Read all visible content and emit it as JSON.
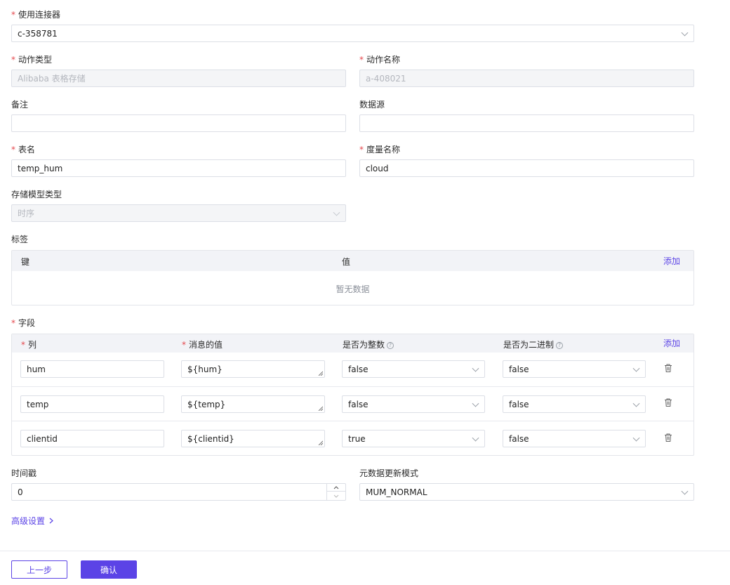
{
  "connector": {
    "label": "使用连接器",
    "value": "c-358781"
  },
  "action_type": {
    "label": "动作类型",
    "value": "Alibaba 表格存储"
  },
  "action_name": {
    "label": "动作名称",
    "value": "a-408021"
  },
  "remark": {
    "label": "备注",
    "value": ""
  },
  "data_source": {
    "label": "数据源",
    "value": ""
  },
  "table_name": {
    "label": "表名",
    "value": "temp_hum"
  },
  "measurement": {
    "label": "度量名称",
    "value": "cloud"
  },
  "storage_model": {
    "label": "存储模型类型",
    "value": "时序"
  },
  "tags": {
    "label": "标签",
    "col_key": "键",
    "col_value": "值",
    "add_label": "添加",
    "empty_text": "暂无数据"
  },
  "fields": {
    "label": "字段",
    "col_column": "列",
    "col_msg_value": "消息的值",
    "col_is_integer": "是否为整数",
    "col_is_binary": "是否为二进制",
    "add_label": "添加",
    "help_glyph": "?",
    "rows": [
      {
        "column": "hum",
        "msg_value": "${hum}",
        "is_integer": "false",
        "is_binary": "false"
      },
      {
        "column": "temp",
        "msg_value": "${temp}",
        "is_integer": "false",
        "is_binary": "false"
      },
      {
        "column": "clientid",
        "msg_value": "${clientid}",
        "is_integer": "true",
        "is_binary": "false"
      }
    ]
  },
  "timestamp": {
    "label": "时间戳",
    "value": "0"
  },
  "meta_update_mode": {
    "label": "元数据更新模式",
    "value": "MUM_NORMAL"
  },
  "advanced": {
    "label": "高级设置"
  },
  "footer": {
    "prev_label": "上一步",
    "confirm_label": "确认"
  },
  "colors": {
    "accent": "#5b43e6",
    "required": "#e5484d",
    "border": "#dcdfe6"
  },
  "icons": {
    "dropdown": "chevron-down-icon",
    "delete": "trash-icon",
    "help": "question-circle-icon",
    "advanced": "chevron-right-icon"
  }
}
